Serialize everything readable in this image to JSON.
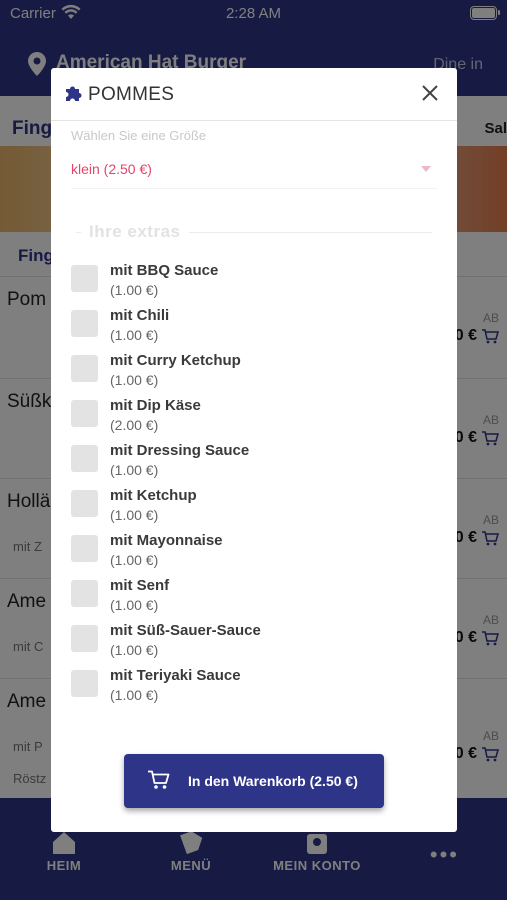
{
  "status_bar": {
    "carrier": "Carrier",
    "time": "2:28 AM"
  },
  "header": {
    "restaurant": "American Hat Burger",
    "mode": "Dine in"
  },
  "background": {
    "tab_left": "Fing",
    "tab_right": "Sal",
    "section": "Fing",
    "rows": [
      {
        "name": "Pom",
        "desc": "",
        "desc2": "",
        "ab": "AB",
        "price": "0 €"
      },
      {
        "name": "Süßk",
        "desc": "",
        "desc2": "",
        "ab": "AB",
        "price": "0 €"
      },
      {
        "name": "Hollä",
        "desc": "mit Z",
        "desc2": "",
        "ab": "AB",
        "price": "0 €"
      },
      {
        "name": "Ame",
        "desc": "mit C",
        "desc2": "",
        "ab": "AB",
        "price": "0 €"
      },
      {
        "name": "Ame",
        "desc": "mit P",
        "desc2": "Röstz",
        "ab": "AB",
        "price": "0 €"
      }
    ]
  },
  "nav": {
    "home": "HEIM",
    "menu": "MENÜ",
    "account": "MEIN KONTO",
    "more": "•••"
  },
  "modal": {
    "title": "POMMES",
    "size_label": "Wählen Sie eine Größe",
    "size_value": "klein (2.50 €)",
    "extras_title": "Ihre extras",
    "options": [
      {
        "name": "mit BBQ Sauce",
        "price": "(1.00 €)"
      },
      {
        "name": "mit Chili",
        "price": "(1.00 €)"
      },
      {
        "name": "mit Curry Ketchup",
        "price": "(1.00 €)"
      },
      {
        "name": "mit Dip Käse",
        "price": "(2.00 €)"
      },
      {
        "name": "mit Dressing Sauce",
        "price": "(1.00 €)"
      },
      {
        "name": "mit Ketchup",
        "price": "(1.00 €)"
      },
      {
        "name": "mit Mayonnaise",
        "price": "(1.00 €)"
      },
      {
        "name": "mit Senf",
        "price": "(1.00 €)"
      },
      {
        "name": "mit Süß-Sauer-Sauce",
        "price": "(1.00 €)"
      },
      {
        "name": "mit Teriyaki Sauce",
        "price": "(1.00 €)"
      }
    ],
    "add_button": "In den Warenkorb (2.50 €)"
  },
  "colors": {
    "primary": "#2e3487",
    "accent": "#e4456a"
  }
}
